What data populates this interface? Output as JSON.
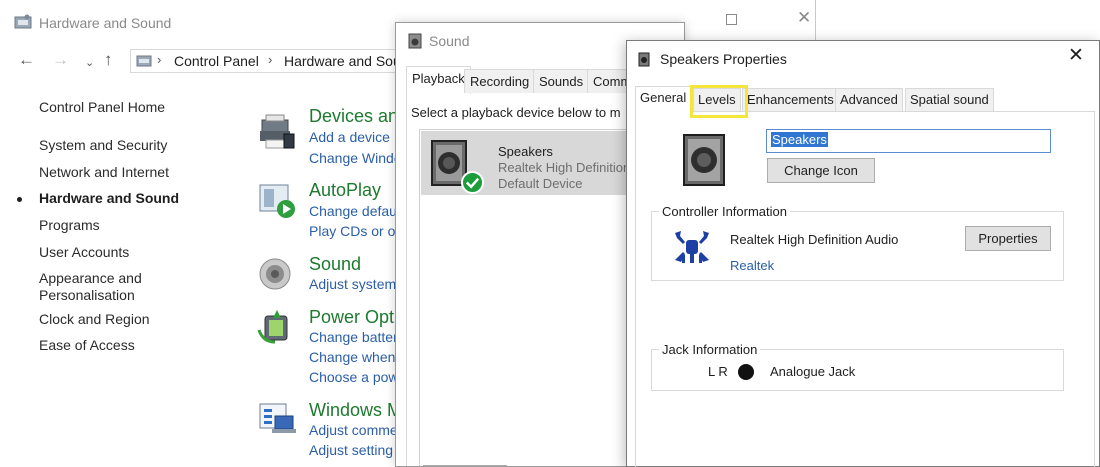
{
  "control_panel": {
    "title": "Hardware and Sound",
    "breadcrumbs": [
      "Control Panel",
      "Hardware and Sou"
    ],
    "sidebar": [
      {
        "label": "Control Panel Home",
        "active": false
      },
      {
        "label": "System and Security",
        "active": false
      },
      {
        "label": "Network and Internet",
        "active": false
      },
      {
        "label": "Hardware and Sound",
        "active": true
      },
      {
        "label": "Programs",
        "active": false
      },
      {
        "label": "User Accounts",
        "active": false
      },
      {
        "label": "Appearance and",
        "active": false
      },
      {
        "label": "Personalisation",
        "active": false
      },
      {
        "label": "Clock and Region",
        "active": false
      },
      {
        "label": "Ease of Access",
        "active": false
      }
    ],
    "categories": [
      {
        "title": "Devices an",
        "links": [
          "Add a device",
          "Change Windo"
        ],
        "icon": "devices-printers-icon"
      },
      {
        "title": "AutoPlay",
        "links": [
          "Change defau",
          "Play CDs or ot"
        ],
        "icon": "autoplay-icon"
      },
      {
        "title": "Sound",
        "links": [
          "Adjust system"
        ],
        "icon": "speaker-icon"
      },
      {
        "title": "Power Opti",
        "links": [
          "Change batter",
          "Change when",
          "Choose a pow"
        ],
        "icon": "power-options-icon"
      },
      {
        "title": "Windows M",
        "links": [
          "Adjust comme",
          "Adjust setting"
        ],
        "icon": "windows-mobility-icon"
      }
    ]
  },
  "sound_dialog": {
    "title": "Sound",
    "tabs": [
      "Playback",
      "Recording",
      "Sounds",
      "Comm"
    ],
    "active_tab": "Playback",
    "instruction": "Select a playback device below to m",
    "device": {
      "name": "Speakers",
      "description": "Realtek High Definition",
      "status": "Default Device"
    }
  },
  "speakers_properties": {
    "title": "Speakers Properties",
    "tabs": [
      "General",
      "Levels",
      "Enhancements",
      "Advanced",
      "Spatial sound"
    ],
    "active_tab": "General",
    "highlighted_tab": "Levels",
    "highlight_color": "#f5e63d",
    "device_name": "Speakers",
    "change_icon_label": "Change Icon",
    "controller": {
      "group_label": "Controller Information",
      "name": "Realtek High Definition Audio",
      "vendor": "Realtek",
      "properties_label": "Properties"
    },
    "jack": {
      "group_label": "Jack Information",
      "channels": "L R",
      "type": "Analogue Jack"
    }
  },
  "colors": {
    "category_title": "#1d7a2f",
    "link": "#2a5ea8",
    "selected_text_bg": "#3176d3",
    "default_check": "#1a9d3a"
  }
}
